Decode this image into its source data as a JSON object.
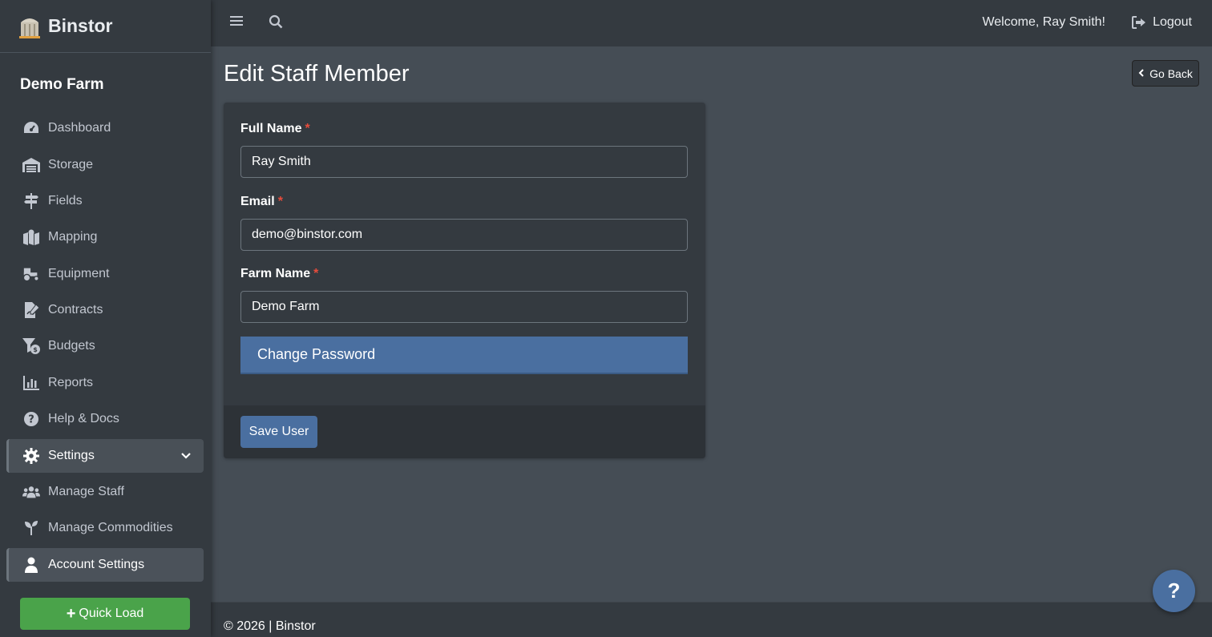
{
  "brand": {
    "name": "Binstor"
  },
  "farm": {
    "title": "Demo Farm"
  },
  "sidebar": {
    "items": [
      {
        "label": "Dashboard",
        "icon": "dashboard-icon"
      },
      {
        "label": "Storage",
        "icon": "warehouse-icon"
      },
      {
        "label": "Fields",
        "icon": "signpost-icon"
      },
      {
        "label": "Mapping",
        "icon": "map-icon"
      },
      {
        "label": "Equipment",
        "icon": "tractor-icon"
      },
      {
        "label": "Contracts",
        "icon": "contract-icon"
      },
      {
        "label": "Budgets",
        "icon": "budget-icon"
      },
      {
        "label": "Reports",
        "icon": "chart-icon"
      },
      {
        "label": "Help & Docs",
        "icon": "question-icon"
      },
      {
        "label": "Settings",
        "icon": "gear-icon"
      },
      {
        "label": "Manage Staff",
        "icon": "users-icon"
      },
      {
        "label": "Manage Commodities",
        "icon": "seedling-icon"
      },
      {
        "label": "Account Settings",
        "icon": "user-icon"
      }
    ],
    "quick_load": "Quick Load"
  },
  "topbar": {
    "welcome": "Welcome, Ray Smith!",
    "logout": "Logout"
  },
  "page": {
    "title": "Edit Staff Member",
    "go_back": "Go Back"
  },
  "form": {
    "full_name_label": "Full Name",
    "full_name_value": "Ray Smith",
    "email_label": "Email",
    "email_value": "demo@binstor.com",
    "farm_name_label": "Farm Name",
    "farm_name_value": "Demo Farm",
    "required_mark": "*",
    "change_password": "Change Password",
    "save": "Save User"
  },
  "footer": {
    "text": "© 2026 | Binstor"
  },
  "help": {
    "label": "?"
  },
  "colors": {
    "accent": "#4a6fa0",
    "quick_load": "#4aa34a",
    "required": "#e74c3c"
  }
}
